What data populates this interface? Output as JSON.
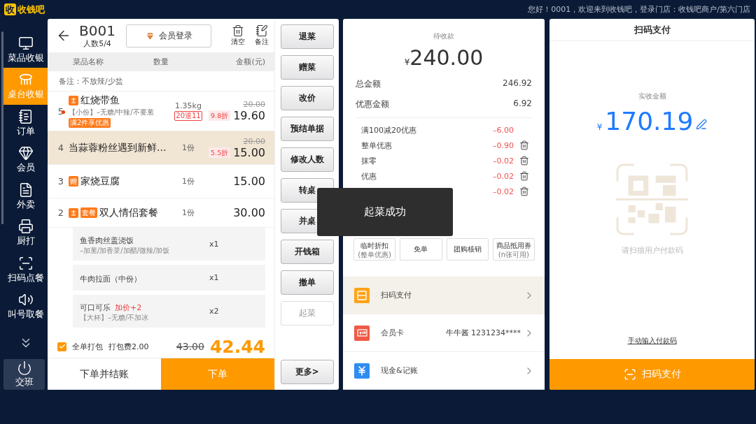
{
  "topbar": {
    "logo_mark": "收",
    "logo_text": "收钱吧",
    "greeting": "您好！0001，欢迎来到收钱吧，登录门店：收钱吧商户/第六门店"
  },
  "sidebar": {
    "items": [
      {
        "label": "菜品收银",
        "selected": false
      },
      {
        "label": "桌台收银",
        "selected": true
      },
      {
        "label": "订单",
        "selected": false
      },
      {
        "label": "会员",
        "selected": false
      },
      {
        "label": "外卖",
        "selected": false
      },
      {
        "label": "厨打",
        "selected": false
      },
      {
        "label": "扫码点餐",
        "selected": false
      },
      {
        "label": "叫号取餐",
        "selected": false
      }
    ],
    "shift": {
      "label": "交班"
    }
  },
  "order": {
    "table": "B001",
    "guests": "人数5/4",
    "member_login": "会员登录",
    "actions": [
      {
        "label": "清空"
      },
      {
        "label": "备注"
      }
    ],
    "columns": [
      "菜品名称",
      "数量",
      "金额(元)"
    ],
    "note": "备注：不放辣/少盐",
    "rows": [
      {
        "index": "5",
        "dot": true,
        "selected": false,
        "badges": [
          {
            "kind": "scale"
          }
        ],
        "name": "红烧带鱼",
        "spec": "【小份】–无糖/中辣/不要葱",
        "promo": "满2件享优惠",
        "qty": "1.35kg",
        "qty_tag": "20退11",
        "original": "20.00",
        "discount": "9.8折",
        "price": "19.60"
      },
      {
        "index": "4",
        "dot": false,
        "selected": true,
        "name": "当蒜蓉粉丝遇到新鲜…",
        "qty": "1份",
        "original": "20.00",
        "discount": "5.5折",
        "price": "15.00"
      },
      {
        "index": "3",
        "dot": false,
        "selected": false,
        "badges": [
          {
            "kind": "text",
            "text": "赠"
          }
        ],
        "name": "家烧豆腐",
        "qty": "1份",
        "price": "15.00"
      },
      {
        "index": "2",
        "dot": false,
        "selected": false,
        "badges": [
          {
            "kind": "scale"
          },
          {
            "kind": "text",
            "text": "套餐"
          }
        ],
        "name": "双人情侣套餐",
        "qty": "1份",
        "price": "30.00",
        "children": [
          {
            "name": "鱼香肉丝盖浇饭",
            "spec": "–加葱/加香菜/加醋/微辣/加饭",
            "qty": "x1"
          },
          {
            "name": "牛肉拉面（中份）",
            "qty": "x1"
          },
          {
            "name": "可口可乐",
            "surcharge": "加价+2",
            "spec": "【大杯】–无糖/不加冰",
            "qty": "x2"
          }
        ]
      }
    ],
    "pack_all": {
      "label": "全单打包",
      "checked": true
    },
    "pack_fee": "打包费2.00",
    "original_total": "43.00",
    "total": "42.44",
    "bottom_buttons": [
      {
        "label": "下单并结账",
        "kind": "secondary"
      },
      {
        "label": "下单",
        "kind": "primary"
      }
    ]
  },
  "action_buttons": [
    {
      "label": "退菜",
      "disabled": false
    },
    {
      "label": "赠菜",
      "disabled": false
    },
    {
      "label": "改价",
      "disabled": false
    },
    {
      "label": "预结单据",
      "disabled": false
    },
    {
      "label": "修改人数",
      "disabled": false
    },
    {
      "label": "转桌",
      "disabled": false
    },
    {
      "label": "并桌",
      "disabled": false
    },
    {
      "label": "开钱箱",
      "disabled": false
    },
    {
      "label": "撤单",
      "disabled": false
    },
    {
      "label": "起菜",
      "disabled": true
    }
  ],
  "more_button": "更多>",
  "payment": {
    "due_label": "待收款",
    "currency": "¥",
    "due": "240.00",
    "summary": [
      {
        "label": "总金额",
        "value": "246.92"
      },
      {
        "label": "优惠金额",
        "value": "6.92"
      }
    ],
    "discounts": [
      {
        "label": "满100减20优惠",
        "amount": "–6.00",
        "deletable": false
      },
      {
        "label": "整单优惠",
        "amount": "–0.90",
        "deletable": true
      },
      {
        "label": "抹零",
        "amount": "–0.02",
        "deletable": true
      },
      {
        "label": "优惠",
        "amount": "–0.02",
        "deletable": true
      },
      {
        "amount": "–0.02",
        "deletable": true
      }
    ],
    "quick_buttons": [
      {
        "label": "临时折扣",
        "note": "(整单优惠)"
      },
      {
        "label": "免单"
      },
      {
        "label": "团购核销"
      },
      {
        "label": "商品抵用券",
        "note": "(n张可用)"
      }
    ],
    "methods": [
      {
        "label": "扫码支付",
        "selected": true
      },
      {
        "label": "会员卡",
        "detail": "牛牛酱 1231234****",
        "selected": false
      },
      {
        "label": "现金&记账",
        "selected": false
      }
    ]
  },
  "scan_panel": {
    "title": "扫码支付",
    "received_label": "实收金额",
    "currency": "¥",
    "amount": "170.19",
    "hint": "请扫描用户付款码",
    "manual_link": "手动输入付款码",
    "pay_button": "扫码支付"
  },
  "toast": {
    "text": "起菜成功"
  }
}
